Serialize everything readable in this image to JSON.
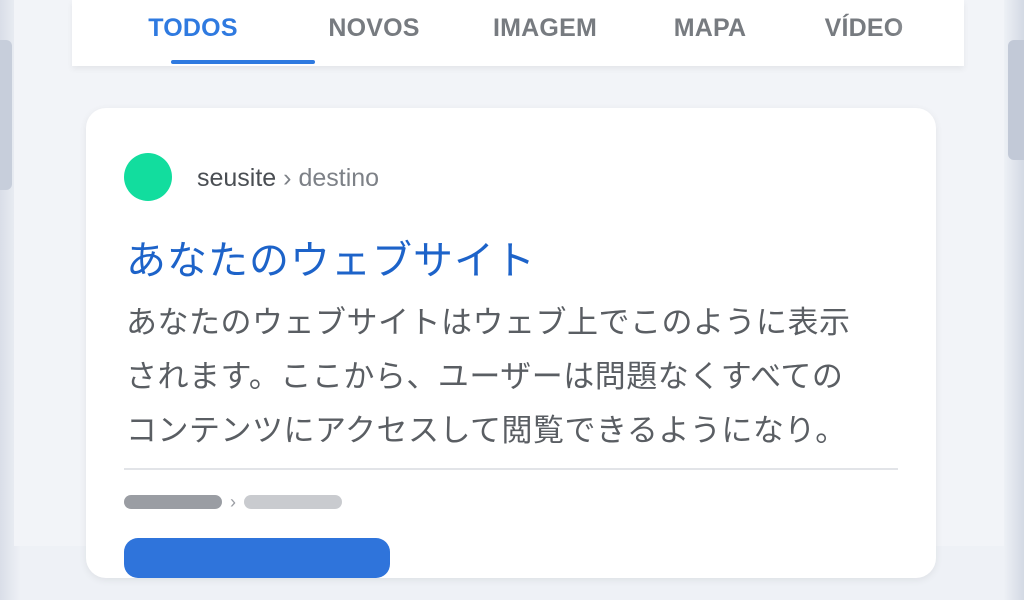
{
  "tabs": [
    {
      "label": "TODOS",
      "active": true
    },
    {
      "label": "NOVOS",
      "active": false
    },
    {
      "label": "IMAGEM",
      "active": false
    },
    {
      "label": "MAPA",
      "active": false
    },
    {
      "label": "VÍDEO",
      "active": false
    }
  ],
  "result": {
    "site": "seusite",
    "separator": "›",
    "path": "destino",
    "title": "あなたのウェブサイト",
    "snippet_lines": [
      "あなたのウェブサイトはウェブ上でこのように表示",
      "されます。ここから、ユーザーは問題なくすべての",
      "コンテンツにアクセスして閲覧できるようになり。"
    ],
    "placeholder_separator": "›"
  },
  "colors": {
    "accent": "#2f7ae0",
    "favicon": "#12dd9e",
    "title_link": "#1d63c9",
    "snippet_text": "#5a5e63",
    "inactive_tab": "#777b80"
  }
}
